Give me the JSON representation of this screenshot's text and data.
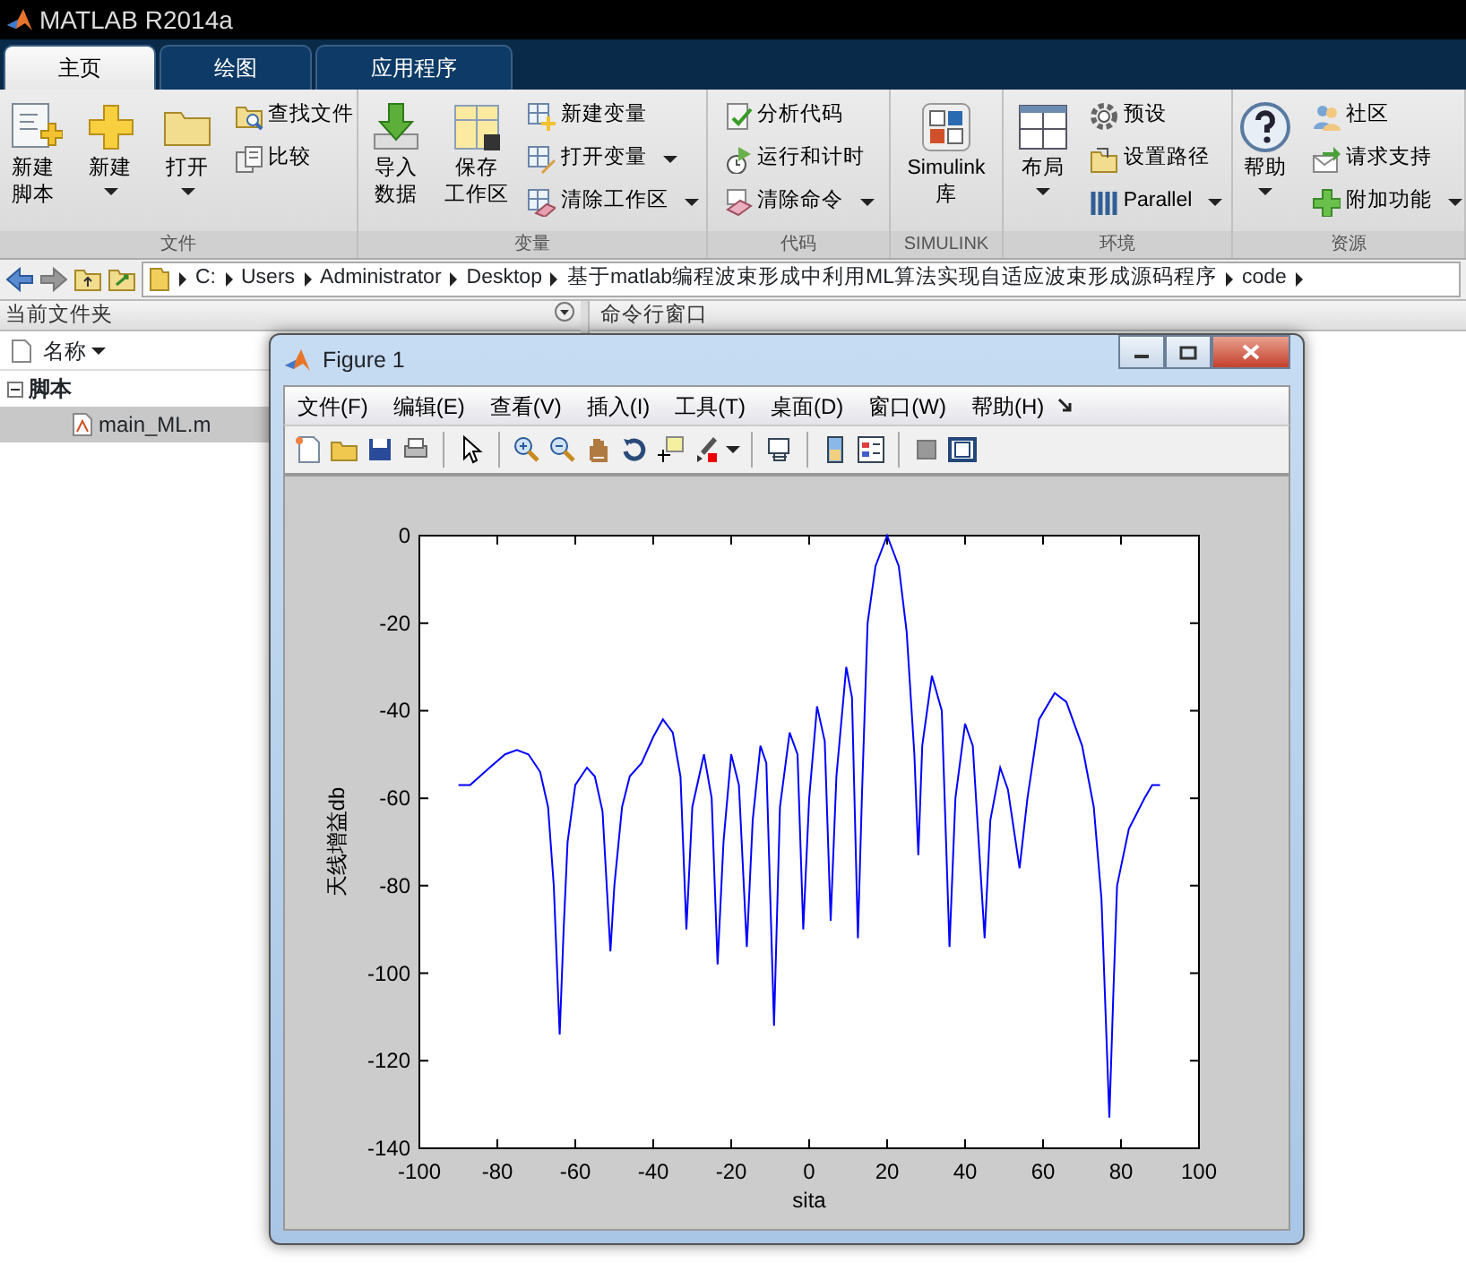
{
  "window": {
    "title": "MATLAB R2014a"
  },
  "tabs": [
    {
      "label": "主页",
      "selected": true
    },
    {
      "label": "绘图",
      "selected": false
    },
    {
      "label": "应用程序",
      "selected": false
    }
  ],
  "toolstrip": [
    {
      "label": "文件",
      "items": [
        {
          "kind": "large",
          "lines": [
            "新建",
            "脚本"
          ],
          "dropdown": false
        },
        {
          "kind": "large",
          "lines": [
            "新建"
          ],
          "dropdown": true
        },
        {
          "kind": "large",
          "lines": [
            "打开"
          ],
          "dropdown": true
        },
        {
          "kind": "small",
          "lines": [
            "查找文件"
          ],
          "dropdown": false
        },
        {
          "kind": "small",
          "lines": [
            "比较"
          ],
          "dropdown": false
        }
      ]
    },
    {
      "label": "变量",
      "items": [
        {
          "kind": "large",
          "lines": [
            "导入",
            "数据"
          ],
          "dropdown": false
        },
        {
          "kind": "large",
          "lines": [
            "保存",
            "工作区"
          ],
          "dropdown": false
        },
        {
          "kind": "small",
          "lines": [
            "新建变量"
          ],
          "dropdown": false
        },
        {
          "kind": "small",
          "lines": [
            "打开变量"
          ],
          "dropdown": true
        },
        {
          "kind": "small",
          "lines": [
            "清除工作区"
          ],
          "dropdown": true
        }
      ]
    },
    {
      "label": "代码",
      "items": [
        {
          "kind": "small",
          "lines": [
            "分析代码"
          ],
          "dropdown": false
        },
        {
          "kind": "small",
          "lines": [
            "运行和计时"
          ],
          "dropdown": false
        },
        {
          "kind": "small",
          "lines": [
            "清除命令"
          ],
          "dropdown": true
        }
      ]
    },
    {
      "label": "SIMULINK",
      "items": [
        {
          "kind": "large",
          "lines": [
            "Simulink",
            "库"
          ],
          "dropdown": false
        }
      ]
    },
    {
      "label": "环境",
      "items": [
        {
          "kind": "large",
          "lines": [
            "布局"
          ],
          "dropdown": true
        },
        {
          "kind": "small",
          "lines": [
            "预设"
          ],
          "dropdown": false
        },
        {
          "kind": "small",
          "lines": [
            "设置路径"
          ],
          "dropdown": false
        },
        {
          "kind": "small",
          "lines": [
            "Parallel"
          ],
          "dropdown": true
        }
      ]
    },
    {
      "label": "资源",
      "items": [
        {
          "kind": "large",
          "lines": [
            "帮助"
          ],
          "dropdown": true
        },
        {
          "kind": "small",
          "lines": [
            "社区"
          ],
          "dropdown": false
        },
        {
          "kind": "small",
          "lines": [
            "请求支持"
          ],
          "dropdown": false
        },
        {
          "kind": "small",
          "lines": [
            "附加功能"
          ],
          "dropdown": true
        }
      ]
    }
  ],
  "address": [
    "C:",
    "Users",
    "Administrator",
    "Desktop",
    "基于matlab编程波束形成中利用ML算法实现自适应波束形成源码程序",
    "code"
  ],
  "folder_panel": {
    "title": "当前文件夹",
    "column": "名称",
    "tree": [
      {
        "label": "脚本",
        "expanded": true,
        "children": [
          {
            "label": "main_ML.m",
            "selected": true
          }
        ]
      }
    ]
  },
  "command_panel": {
    "title": "命令行窗口"
  },
  "figure": {
    "title": "Figure 1",
    "menu": [
      "文件(F)",
      "编辑(E)",
      "查看(V)",
      "插入(I)",
      "工具(T)",
      "桌面(D)",
      "窗口(W)",
      "帮助(H)"
    ],
    "chart_data": {
      "type": "line",
      "xlabel": "sita",
      "ylabel": "天线增益db",
      "x": [
        -90,
        -87,
        -82,
        -78,
        -75,
        -72,
        -69,
        -67,
        -65.5,
        -64,
        -63,
        -62,
        -60,
        -57,
        -55,
        -53,
        -51,
        -50,
        -48,
        -46,
        -43,
        -40,
        -37.5,
        -35,
        -33,
        -31.5,
        -30,
        -27,
        -25,
        -23.5,
        -22,
        -20,
        -18,
        -16,
        -14.5,
        -12.5,
        -11,
        -9,
        -7.5,
        -5,
        -3,
        -1.5,
        0,
        2,
        4,
        5.5,
        7,
        9.5,
        11,
        12.5,
        13.5,
        15,
        17,
        20,
        23,
        25,
        27,
        28,
        29,
        31.5,
        34,
        36,
        37.5,
        40,
        42,
        45,
        46.5,
        49,
        51,
        54,
        56,
        59,
        63,
        66,
        70,
        73,
        75,
        77,
        78,
        79,
        82,
        86,
        88,
        90
      ],
      "series": [
        {
          "color": "#0000ff",
          "values": [
            -57,
            -57,
            -53,
            -50,
            -49,
            -50,
            -54,
            -62,
            -80,
            -114,
            -90,
            -70,
            -57,
            -53,
            -55,
            -63,
            -95,
            -80,
            -62,
            -55,
            -52,
            -46,
            -42,
            -45,
            -55,
            -90,
            -62,
            -50,
            -60,
            -98,
            -70,
            -50,
            -57,
            -94,
            -65,
            -48,
            -52,
            -112,
            -62,
            -45,
            -50,
            -90,
            -60,
            -39,
            -47,
            -88,
            -55,
            -30,
            -37,
            -92,
            -60,
            -20,
            -7,
            0,
            -7,
            -22,
            -50,
            -73,
            -48,
            -32,
            -40,
            -94,
            -60,
            -43,
            -48,
            -92,
            -65,
            -53,
            -58,
            -76,
            -60,
            -42,
            -36,
            -38,
            -48,
            -62,
            -83,
            -133,
            -105,
            -80,
            -67,
            -60,
            -57,
            -57
          ]
        }
      ],
      "xlim": [
        -100,
        100
      ],
      "ylim": [
        -140,
        0
      ],
      "xticks": [
        -100,
        -80,
        -60,
        -40,
        -20,
        0,
        20,
        40,
        60,
        80,
        100
      ],
      "yticks": [
        -140,
        -120,
        -100,
        -80,
        -60,
        -40,
        -20,
        0
      ]
    }
  }
}
